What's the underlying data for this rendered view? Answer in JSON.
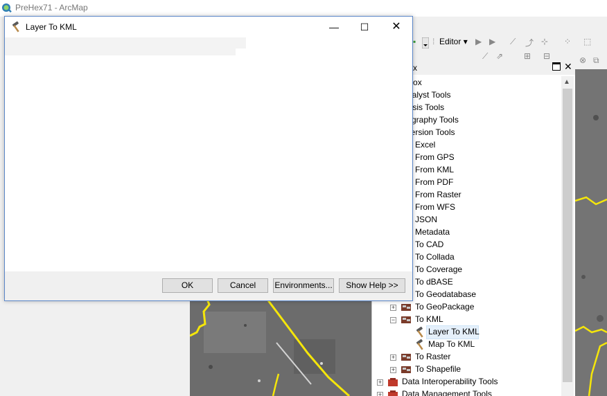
{
  "app": {
    "title": "PreHex71 - ArcMap",
    "icon": "arcmap-globe-icon"
  },
  "toolbar": {
    "editor_label": "Editor"
  },
  "toolbox_panel": {
    "header_title": "x",
    "tree": [
      {
        "label": "olbox",
        "level": 0
      },
      {
        "label": "Analyst Tools",
        "level": 0
      },
      {
        "label": "alysis Tools",
        "level": 0
      },
      {
        "label": "rtography Tools",
        "level": 0
      },
      {
        "label": "nversion Tools",
        "level": 0
      },
      {
        "label": "Excel",
        "level": 1
      },
      {
        "label": "From GPS",
        "level": 1
      },
      {
        "label": "From KML",
        "level": 1
      },
      {
        "label": "From PDF",
        "level": 1
      },
      {
        "label": "From Raster",
        "level": 1
      },
      {
        "label": "From WFS",
        "level": 1
      },
      {
        "label": "JSON",
        "level": 1
      },
      {
        "label": "Metadata",
        "level": 1
      },
      {
        "label": "To CAD",
        "level": 1
      },
      {
        "label": "To Collada",
        "level": 1
      },
      {
        "label": "To Coverage",
        "level": 1
      },
      {
        "label": "To dBASE",
        "level": 1
      },
      {
        "label": "To Geodatabase",
        "level": 1
      },
      {
        "label": "To GeoPackage",
        "level": 1
      },
      {
        "label": "To KML",
        "level": 1
      },
      {
        "label": "Layer To KML",
        "level": 2
      },
      {
        "label": "Map To KML",
        "level": 2
      },
      {
        "label": "To Raster",
        "level": 1
      },
      {
        "label": "To Shapefile",
        "level": 1
      },
      {
        "label": "Data Interoperability Tools",
        "level": 0
      },
      {
        "label": "Data Management Tools",
        "level": 0
      }
    ]
  },
  "dialog": {
    "title": "Layer To KML",
    "minimize": "—",
    "maximize": "☐",
    "close": "✕",
    "buttons": {
      "ok": "OK",
      "cancel": "Cancel",
      "environments": "Environments...",
      "show_help": "Show Help >>"
    }
  },
  "colors": {
    "dialog_border": "#5a86c8",
    "boundary_line": "#f5e60a",
    "selection": "#e5f0fb"
  }
}
